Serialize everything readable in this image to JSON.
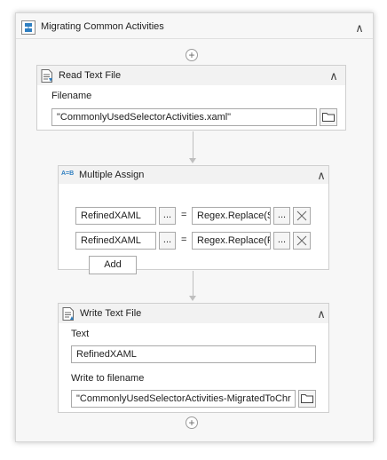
{
  "sequence": {
    "title": "Migrating Common Activities",
    "icon": "sequence-icon",
    "collapse_glyph": "∧",
    "add_glyph": "+"
  },
  "read_text_file": {
    "title": "Read Text File",
    "icon": "read-file-icon",
    "filename_label": "Filename",
    "filename_value": "\"CommonlyUsedSelectorActivities.xaml\"",
    "browse_icon": "folder-icon"
  },
  "multiple_assign": {
    "title": "Multiple Assign",
    "icon": "assign-icon",
    "icon_text": "A=B",
    "rows": [
      {
        "to": "RefinedXAML",
        "ellipsis": "...",
        "equals": "=",
        "value": "Regex.Replace(St",
        "ellipsis2": "...",
        "remove_icon": "close-icon"
      },
      {
        "to": "RefinedXAML",
        "ellipsis": "...",
        "equals": "=",
        "value": "Regex.Replace(Re",
        "ellipsis2": "...",
        "remove_icon": "close-icon"
      }
    ],
    "add_label": "Add"
  },
  "write_text_file": {
    "title": "Write Text File",
    "icon": "write-file-icon",
    "text_label": "Text",
    "text_value": "RefinedXAML",
    "filename_label": "Write to filename",
    "filename_value": "\"CommonlyUsedSelectorActivities-MigratedToChr",
    "browse_icon": "folder-icon"
  },
  "colors": {
    "panel_bg": "#f7f7f7",
    "card_border": "#cfcfcf",
    "field_border": "#a9a9a9",
    "icon_blue": "#2f7fc1"
  }
}
